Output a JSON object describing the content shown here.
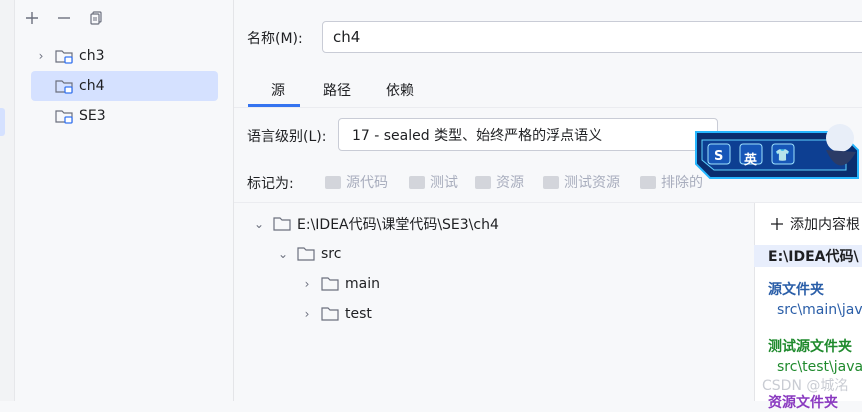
{
  "toolbar": {
    "add_icon": "plus-icon",
    "remove_icon": "minus-icon",
    "copy_icon": "copy-icon"
  },
  "modules": [
    {
      "label": "ch3",
      "expandable": true,
      "selected": false
    },
    {
      "label": "ch4",
      "expandable": false,
      "selected": true
    },
    {
      "label": "SE3",
      "expandable": false,
      "selected": false
    }
  ],
  "name": {
    "label": "名称(M):",
    "value": "ch4"
  },
  "tabs": [
    {
      "label": "源",
      "active": true
    },
    {
      "label": "路径",
      "active": false
    },
    {
      "label": "依赖",
      "active": false
    }
  ],
  "language_level": {
    "label": "语言级别(L):",
    "value": "17 - sealed 类型、始终严格的浮点语义"
  },
  "mark_as": {
    "label": "标记为:",
    "items": [
      "源代码",
      "测试",
      "资源",
      "测试资源",
      "排除的"
    ]
  },
  "tree": {
    "root": "E:\\IDEA代码\\课堂代码\\SE3\\ch4",
    "src": "src",
    "main": "main",
    "test": "test"
  },
  "right_panel": {
    "add_root": "添加内容根",
    "root_path": "E:\\IDEA代码\\",
    "source_folders_title": "源文件夹",
    "source_folder": "src\\main\\java",
    "test_folders_title": "测试源文件夹",
    "test_folder": "src\\test\\java",
    "resource_folders_title": "资源文件夹"
  },
  "overlay": {
    "banner_keys": [
      "S",
      "英",
      "👕"
    ],
    "watermark": "CSDN @城洺"
  },
  "colors": {
    "accent": "#3574f0",
    "selection": "#d5e1ff",
    "source_blue": "#2a5ea8",
    "test_green": "#1f8a2d",
    "resource_purple": "#8a3ac0"
  }
}
